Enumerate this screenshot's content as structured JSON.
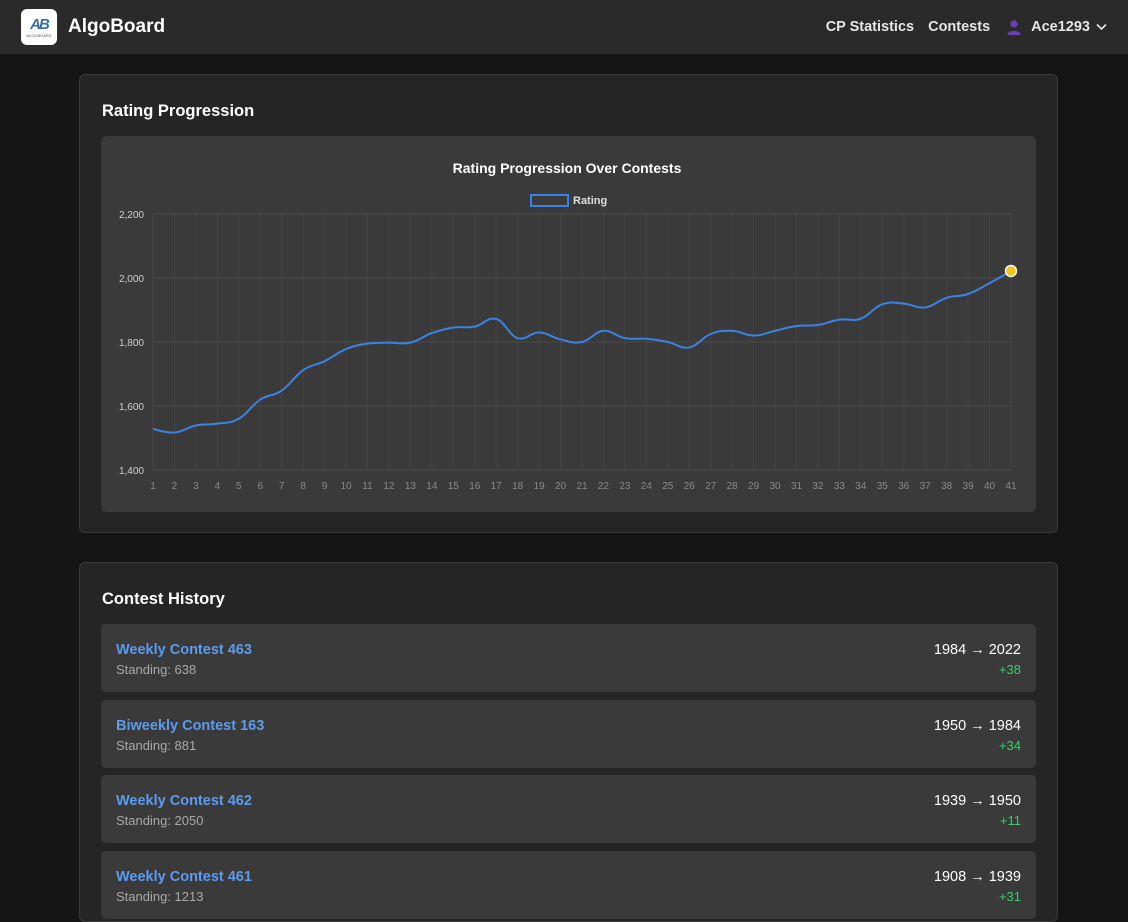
{
  "app": {
    "logo_mark": "AB",
    "logo_subtext": "ALGOBOARD",
    "brand": "AlgoBoard"
  },
  "nav": {
    "cp_statistics": "CP Statistics",
    "contests": "Contests",
    "username": "Ace1293"
  },
  "rating_section": {
    "title": "Rating Progression"
  },
  "chart_data": {
    "type": "line",
    "title": "Rating Progression Over Contests",
    "legend": [
      "Rating"
    ],
    "legend_position": "top",
    "grid": true,
    "xlabel": "",
    "ylabel": "",
    "ylim": [
      1400,
      2200
    ],
    "yticks": [
      "1,400",
      "1,600",
      "1,800",
      "2,000",
      "2,200"
    ],
    "categories": [
      "1",
      "2",
      "3",
      "4",
      "5",
      "6",
      "7",
      "8",
      "9",
      "10",
      "11",
      "12",
      "13",
      "14",
      "15",
      "16",
      "17",
      "18",
      "19",
      "20",
      "21",
      "22",
      "23",
      "24",
      "25",
      "26",
      "27",
      "28",
      "29",
      "30",
      "31",
      "32",
      "33",
      "34",
      "35",
      "36",
      "37",
      "38",
      "39",
      "40",
      "41"
    ],
    "series": [
      {
        "name": "Rating",
        "color": "#3b82e6",
        "highlight_color": "#f5c518",
        "values": [
          1528,
          1517,
          1539,
          1545,
          1560,
          1620,
          1648,
          1712,
          1740,
          1778,
          1795,
          1798,
          1798,
          1828,
          1845,
          1848,
          1872,
          1812,
          1830,
          1808,
          1800,
          1835,
          1812,
          1810,
          1800,
          1783,
          1825,
          1835,
          1820,
          1835,
          1850,
          1853,
          1870,
          1873,
          1918,
          1920,
          1908,
          1938,
          1950,
          1984,
          2022
        ]
      }
    ]
  },
  "contest_history": {
    "title": "Contest History",
    "items": [
      {
        "name": "Weekly Contest 463",
        "standing": "Standing: 638",
        "rating": "1984 → 2022",
        "delta": "+38"
      },
      {
        "name": "Biweekly Contest 163",
        "standing": "Standing: 881",
        "rating": "1950 → 1984",
        "delta": "+34"
      },
      {
        "name": "Weekly Contest 462",
        "standing": "Standing: 2050",
        "rating": "1939 → 1950",
        "delta": "+11"
      },
      {
        "name": "Weekly Contest 461",
        "standing": "Standing: 1213",
        "rating": "1908 → 1939",
        "delta": "+31"
      }
    ]
  }
}
